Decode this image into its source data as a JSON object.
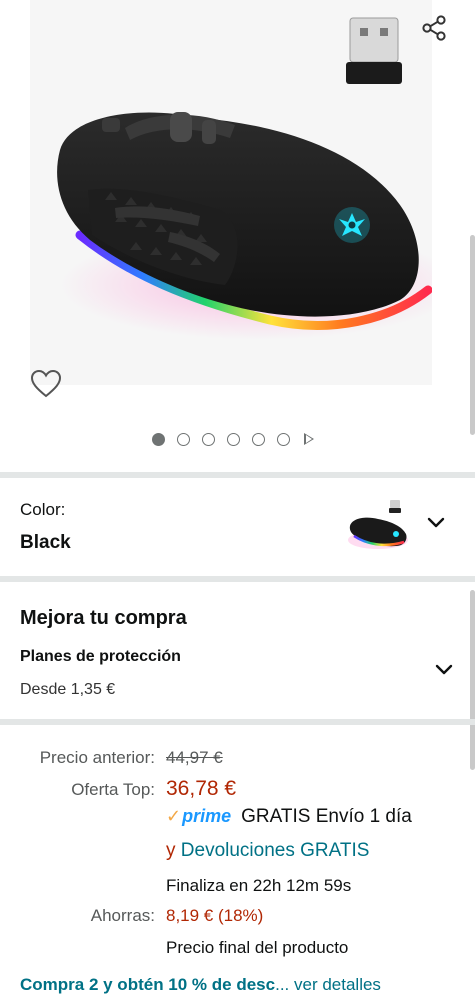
{
  "gallery": {
    "image_alt": "Wireless RGB gaming mouse with USB receiver",
    "share_icon": "share-icon",
    "wishlist_icon": "heart-outline-icon",
    "image_count": 6,
    "active_index": 0,
    "has_video": true
  },
  "color": {
    "label": "Color:",
    "value": "Black"
  },
  "protection": {
    "title": "Mejora tu compra",
    "subtitle": "Planes de protección",
    "from": "Desde 1,35 €"
  },
  "pricing": {
    "previous_label": "Precio anterior:",
    "previous_value": "44,97 €",
    "offer_label": "Oferta Top:",
    "offer_value": "36,78 €",
    "prime_logo": "prime",
    "shipping_text": "GRATIS Envío 1 día",
    "returns_prefix": "y",
    "returns_link": "Devoluciones GRATIS",
    "countdown": "Finaliza en 22h 12m 59s",
    "savings_label": "Ahorras:",
    "savings_value": "8,19 € (18%)",
    "final_price_note": "Precio final del producto"
  },
  "promo": {
    "text": "Compra 2 y obtén 10 % de desc",
    "more": "... ver detalles"
  },
  "colors": {
    "price_red": "#b12704",
    "link_teal": "#007185",
    "prime_blue": "#1a98ff",
    "divider": "#e3e6e6"
  }
}
